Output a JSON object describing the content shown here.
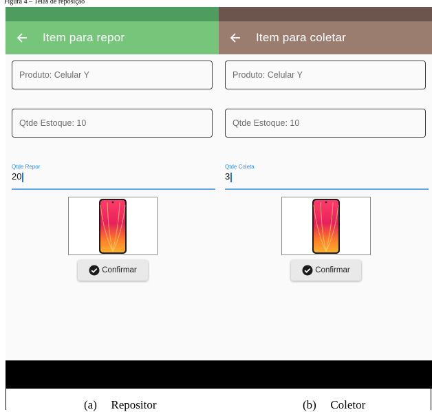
{
  "figure_title_fragment": "Figura 4 – Telas de reposição",
  "colors": {
    "repositor_statusbar": "#4e9c5e",
    "repositor_appbar": "#76c57a",
    "coletor_statusbar": "#6b554c",
    "coletor_appbar": "#9b7d70",
    "focus_blue": "#2f8dea"
  },
  "screens": [
    {
      "title": "Item para repor",
      "product_value": "Produto: Celular Y",
      "stock_value": "Qtde Estoque: 10",
      "qty_label": "Qtde Repor",
      "qty_value": "20",
      "confirm_label": "Confirmar",
      "caption_letter": "(a)",
      "caption_text": "Repositor"
    },
    {
      "title": "Item para coletar",
      "product_value": "Produto: Celular Y",
      "stock_value": "Qtde Estoque: 10",
      "qty_label": "Qtde Coleta",
      "qty_value": "3",
      "confirm_label": "Confirmar",
      "caption_letter": "(b)",
      "caption_text": "Coletor"
    }
  ],
  "icons": [
    "back-arrow-icon",
    "check-circle-icon",
    "phone-image"
  ]
}
